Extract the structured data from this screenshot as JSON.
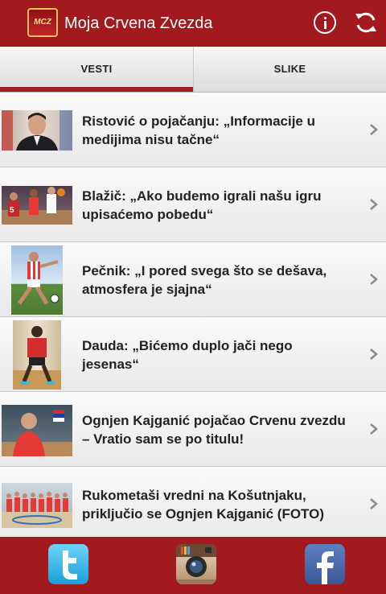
{
  "app": {
    "title": "Moja Crvena Zvezda",
    "logo_text": "MCZ",
    "brand_color": "#a31a1e"
  },
  "header": {
    "info_icon": "info-icon",
    "refresh_icon": "refresh-icon"
  },
  "tabs": [
    {
      "label": "VESTI",
      "selected": true
    },
    {
      "label": "SLIKE",
      "selected": false
    }
  ],
  "news": [
    {
      "title": "Ristović o pojačanju: „Informacije u medijima nisu tačne“",
      "thumb": "man-portrait"
    },
    {
      "title": "Blažič: „Ako budemo igrali našu igru upisaćemo pobedu“",
      "thumb": "basketball-action"
    },
    {
      "title": "Pečnik: „I pored svega što se dešava, atmosfera je sjajna“",
      "thumb": "football-player"
    },
    {
      "title": "Dauda: „Bićemo duplo jači nego jesenas“",
      "thumb": "player-exercise"
    },
    {
      "title": "Ognjen Kajganić pojačao Crvenu zvezdu – Vratio sam se po titulu!",
      "thumb": "player-portrait"
    },
    {
      "title": "Rukometaši vredni na Košutnjaku, priključio se Ognjen Kajganić (FOTO)",
      "thumb": "team-photo"
    }
  ],
  "social": [
    {
      "name": "twitter",
      "icon": "twitter-icon",
      "letter": "t"
    },
    {
      "name": "instagram",
      "icon": "instagram-icon"
    },
    {
      "name": "facebook",
      "icon": "facebook-icon",
      "letter": "f"
    }
  ]
}
